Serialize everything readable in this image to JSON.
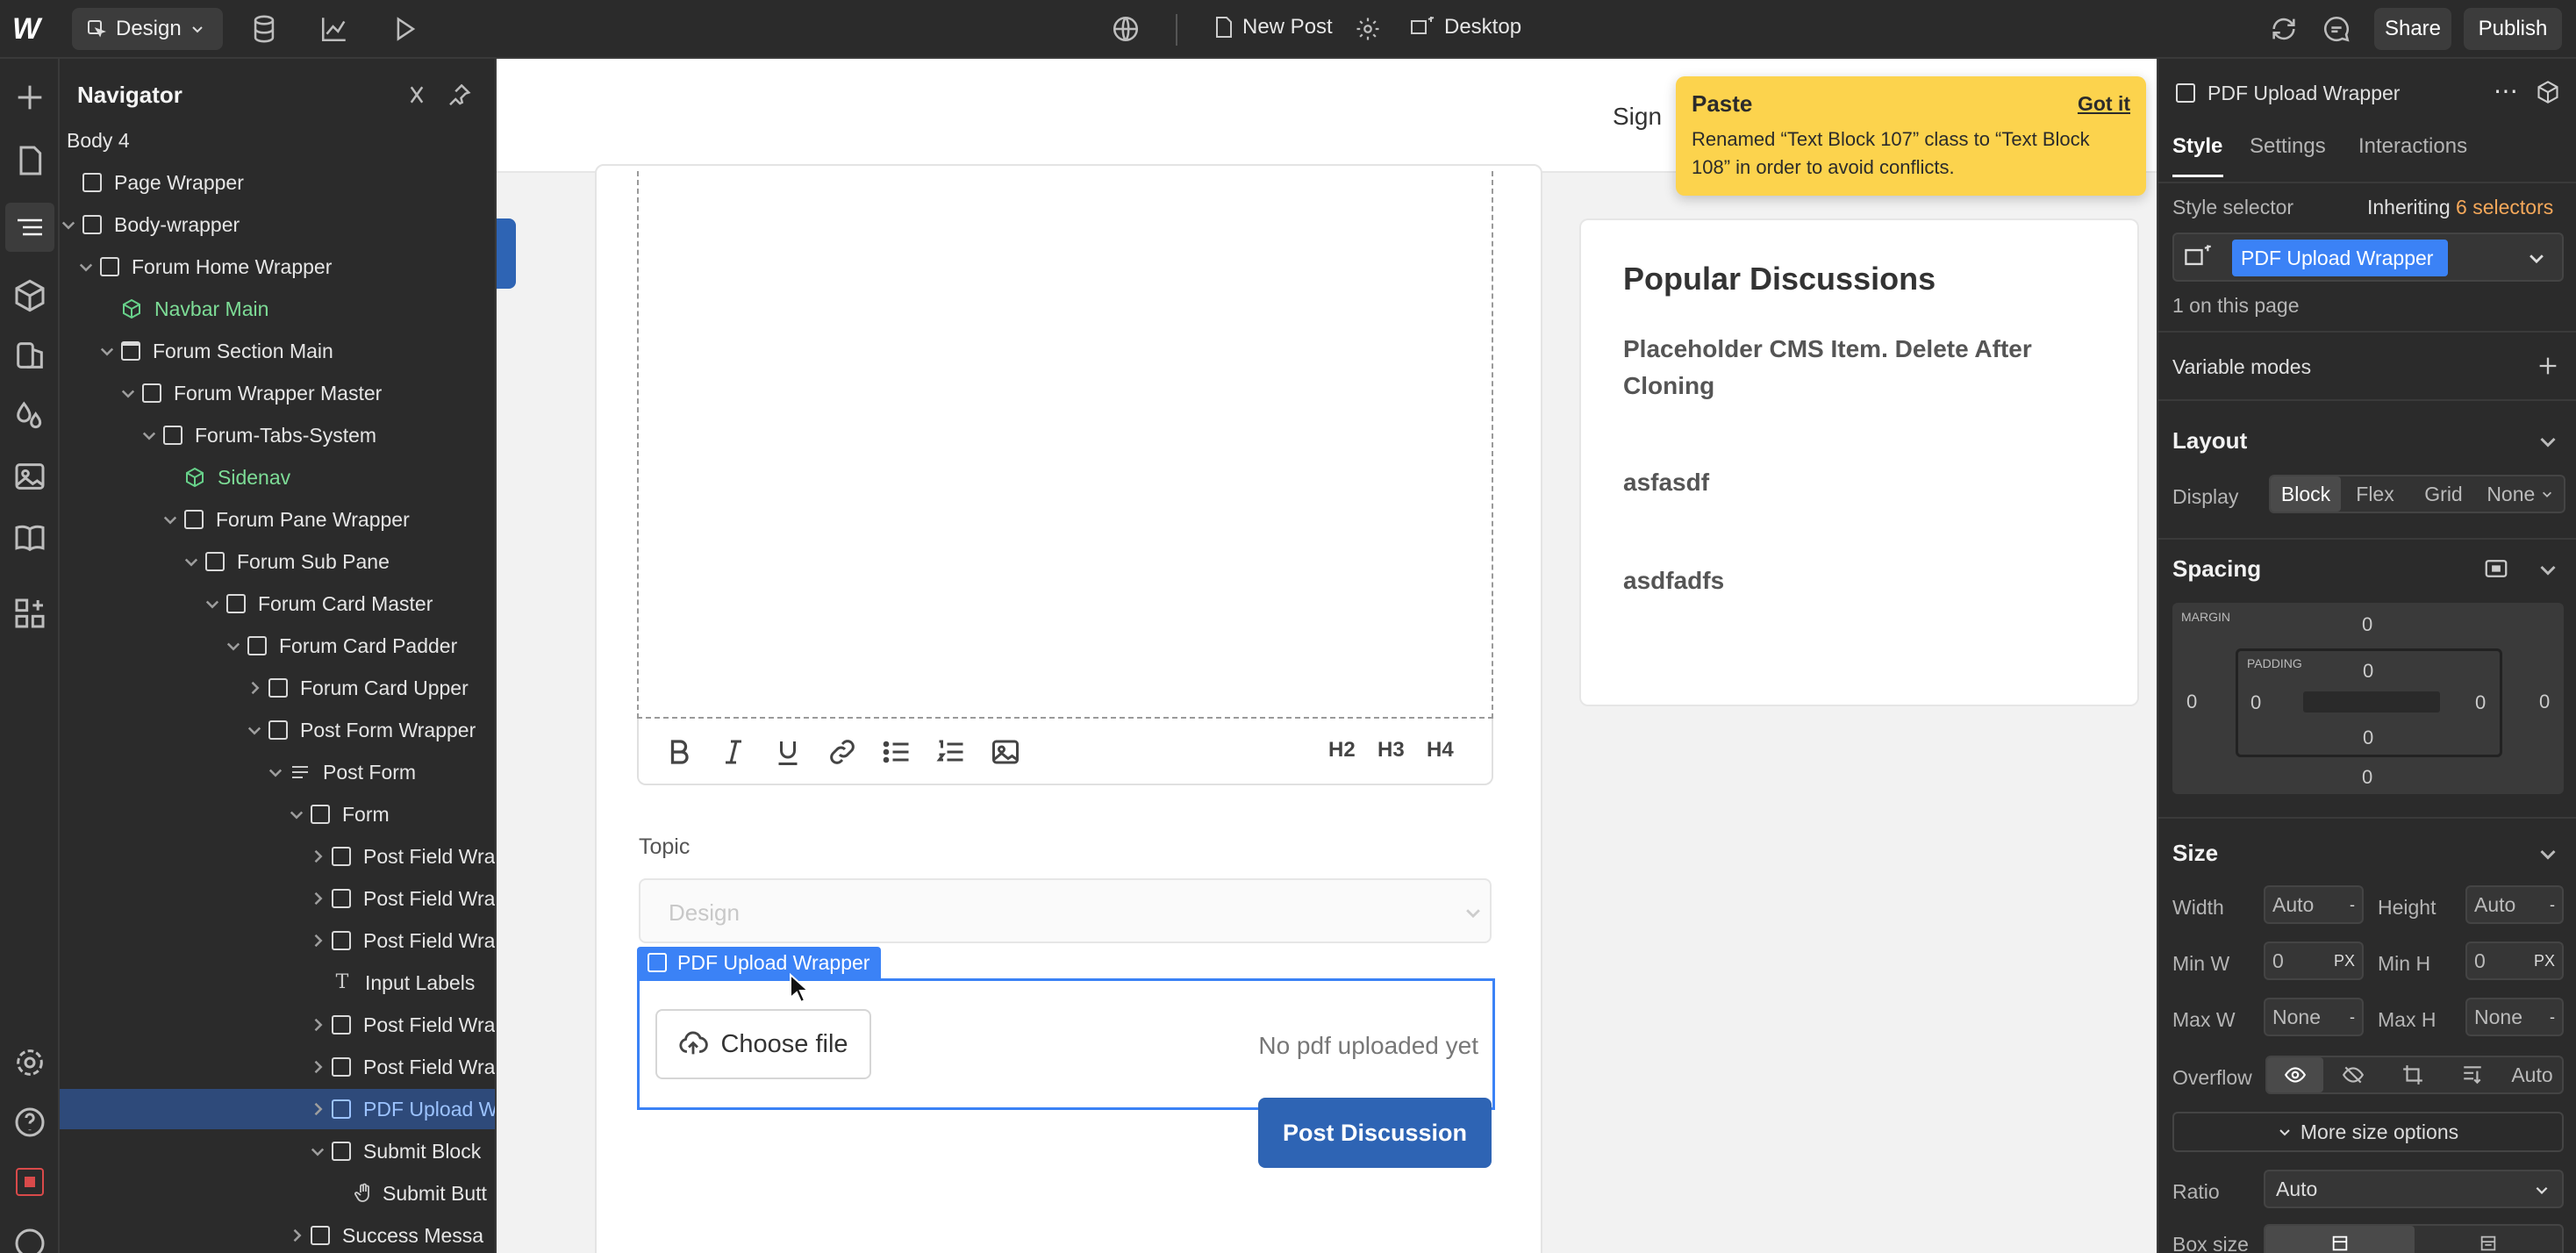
{
  "topbar": {
    "mode_label": "Design",
    "page_name": "New Post",
    "breakpoint": "Desktop",
    "share_label": "Share",
    "publish_label": "Publish"
  },
  "navigator": {
    "title": "Navigator",
    "items": [
      {
        "label": "Body 4",
        "depth": 0,
        "kind": "none",
        "chev": "none"
      },
      {
        "label": "Page Wrapper",
        "depth": 0,
        "kind": "box",
        "chev": "none"
      },
      {
        "label": "Body-wrapper",
        "depth": 0,
        "kind": "box",
        "chev": "down"
      },
      {
        "label": "Forum Home Wrapper",
        "depth": 1,
        "kind": "box",
        "chev": "down"
      },
      {
        "label": "Navbar Main",
        "depth": 2,
        "kind": "component",
        "chev": "none"
      },
      {
        "label": "Forum Section Main",
        "depth": 2,
        "kind": "section",
        "chev": "down"
      },
      {
        "label": "Forum Wrapper Master",
        "depth": 3,
        "kind": "box",
        "chev": "down"
      },
      {
        "label": "Forum-Tabs-System",
        "depth": 4,
        "kind": "box",
        "chev": "down"
      },
      {
        "label": "Sidenav",
        "depth": 5,
        "kind": "component",
        "chev": "none"
      },
      {
        "label": "Forum Pane Wrapper",
        "depth": 5,
        "kind": "box",
        "chev": "down"
      },
      {
        "label": "Forum Sub Pane",
        "depth": 6,
        "kind": "box",
        "chev": "down"
      },
      {
        "label": "Forum Card Master",
        "depth": 7,
        "kind": "box",
        "chev": "down"
      },
      {
        "label": "Forum Card Padder",
        "depth": 8,
        "kind": "box",
        "chev": "down"
      },
      {
        "label": "Forum Card Upper",
        "depth": 9,
        "kind": "box",
        "chev": "right"
      },
      {
        "label": "Post Form Wrapper",
        "depth": 9,
        "kind": "box",
        "chev": "down"
      },
      {
        "label": "Post Form",
        "depth": 10,
        "kind": "form",
        "chev": "down"
      },
      {
        "label": "Form",
        "depth": 11,
        "kind": "box",
        "chev": "down"
      },
      {
        "label": "Post Field Wra",
        "depth": 12,
        "kind": "box",
        "chev": "right"
      },
      {
        "label": "Post Field Wra",
        "depth": 12,
        "kind": "box",
        "chev": "right"
      },
      {
        "label": "Post Field Wra",
        "depth": 12,
        "kind": "box",
        "chev": "right"
      },
      {
        "label": "Input Labels",
        "depth": 12,
        "kind": "text",
        "chev": "none"
      },
      {
        "label": "Post Field Wra",
        "depth": 12,
        "kind": "box",
        "chev": "right"
      },
      {
        "label": "Post Field Wra",
        "depth": 12,
        "kind": "box",
        "chev": "right"
      },
      {
        "label": "PDF Upload W",
        "depth": 12,
        "kind": "box",
        "chev": "right",
        "selected": true
      },
      {
        "label": "Submit Block",
        "depth": 12,
        "kind": "box",
        "chev": "down"
      },
      {
        "label": "Submit Butt",
        "depth": 13,
        "kind": "hand",
        "chev": "none"
      },
      {
        "label": "Success Messa",
        "depth": 11,
        "kind": "box",
        "chev": "right"
      }
    ]
  },
  "canvas": {
    "sign_text": "Sign",
    "editor_tools": [
      "H2",
      "H3",
      "H4"
    ],
    "topic_label": "Topic",
    "topic_value": "Design",
    "upload_tag": "PDF Upload Wrapper",
    "choose_file": "Choose file",
    "no_pdf": "No pdf uploaded yet",
    "post_button": "Post Discussion",
    "popular_title": "Popular Discussions",
    "popular_items": [
      "Placeholder CMS Item. Delete After Cloning",
      "asfasdf",
      "asdfadfs"
    ]
  },
  "toast": {
    "title": "Paste",
    "action": "Got it",
    "message": "Renamed “Text Block 107” class to “Text Block 108” in order to avoid conflicts."
  },
  "panel": {
    "element_name": "PDF Upload Wrapper",
    "tabs": [
      "Style",
      "Settings",
      "Interactions"
    ],
    "style_selector_label": "Style selector",
    "inheriting_prefix": "Inheriting",
    "inheriting_count": "6 selectors",
    "selector_chip": "PDF Upload Wrapper",
    "on_page": "1 on this page",
    "variable_modes": "Variable modes",
    "layout": {
      "title": "Layout",
      "display_label": "Display",
      "options": [
        "Block",
        "Flex",
        "Grid",
        "None"
      ]
    },
    "spacing": {
      "title": "Spacing",
      "margin_label": "MARGIN",
      "padding_label": "PADDING",
      "margin": {
        "top": "0",
        "right": "0",
        "bottom": "0",
        "left": "0"
      },
      "padding": {
        "top": "0",
        "right": "0",
        "bottom": "0",
        "left": "0"
      }
    },
    "size": {
      "title": "Size",
      "width_label": "Width",
      "width_value": "Auto",
      "height_label": "Height",
      "height_value": "Auto",
      "minw_label": "Min W",
      "minw_value": "0",
      "minw_unit": "PX",
      "minh_label": "Min H",
      "minh_value": "0",
      "minh_unit": "PX",
      "maxw_label": "Max W",
      "maxw_value": "None",
      "maxh_label": "Max H",
      "maxh_value": "None",
      "overflow_label": "Overflow",
      "overflow_auto": "Auto",
      "more_options": "More size options",
      "ratio_label": "Ratio",
      "ratio_value": "Auto",
      "boxsize_label": "Box size"
    }
  },
  "colors": {
    "accent": "#3b82f6",
    "primary_button": "#2e64b4",
    "toast": "#fcd34d",
    "component": "#7ddc96",
    "inheriting": "#f5a85a"
  }
}
